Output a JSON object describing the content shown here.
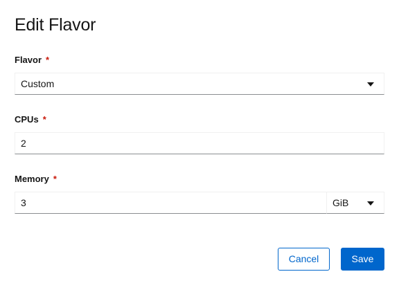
{
  "title": "Edit Flavor",
  "required_marker": "*",
  "flavor": {
    "label": "Flavor",
    "value": "Custom",
    "caret_icon": "caret-down-icon"
  },
  "cpus": {
    "label": "CPUs",
    "value": "2"
  },
  "memory": {
    "label": "Memory",
    "value": "3",
    "unit": "GiB",
    "caret_icon": "caret-down-icon"
  },
  "actions": {
    "cancel_label": "Cancel",
    "save_label": "Save"
  },
  "colors": {
    "primary": "#0066cc",
    "required": "#c9190b",
    "text": "#151515"
  }
}
